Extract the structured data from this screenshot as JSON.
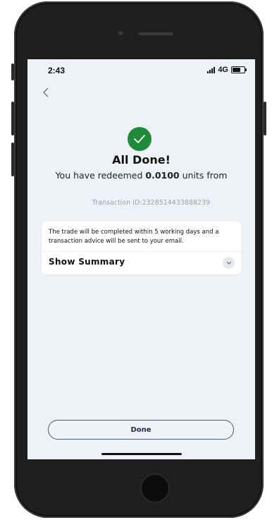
{
  "status_bar": {
    "time": "2:43",
    "network": "4G"
  },
  "header": {
    "back_icon": "chevron-left-icon"
  },
  "result": {
    "icon": "check-circle-icon",
    "title": "All Done!",
    "message_prefix": "You have redeemed ",
    "units": "0.0100",
    "message_suffix": " units from",
    "transaction_label": "Transaction ID:",
    "transaction_id": "2328514433888239"
  },
  "card": {
    "note": "The trade will be completed within 5 working days and a transaction advice will be sent to your email.",
    "summary_label": "Show Summary",
    "expand_icon": "chevron-down-icon"
  },
  "actions": {
    "done_label": "Done"
  },
  "colors": {
    "success": "#1e8b3a",
    "accent": "#4b5d7a",
    "background": "#eef1f5"
  }
}
